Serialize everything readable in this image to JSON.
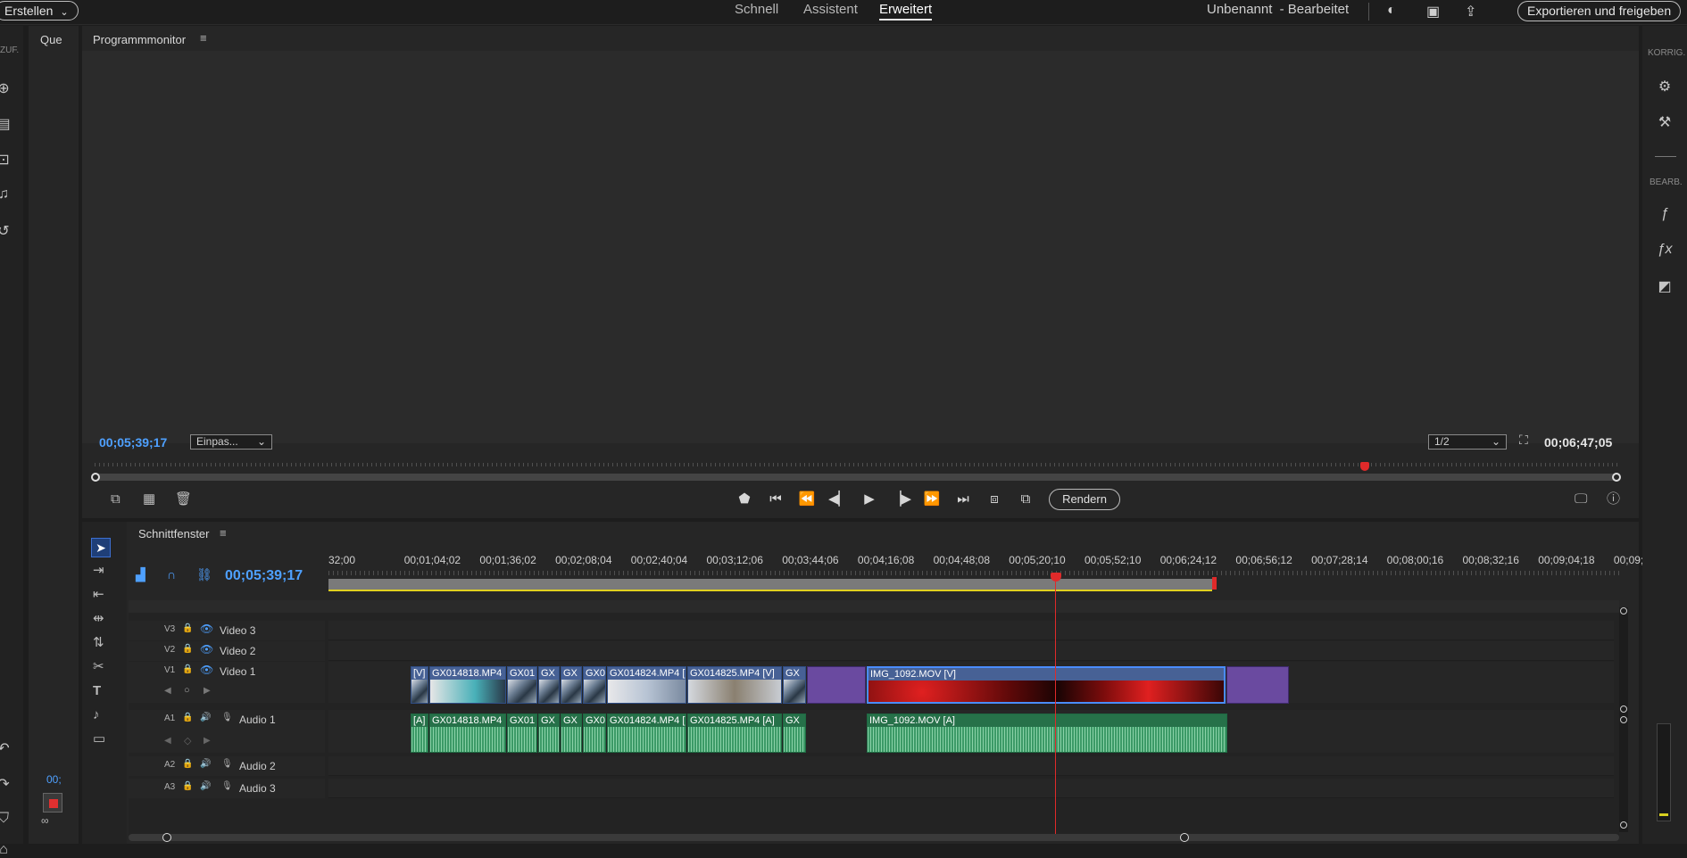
{
  "topbar": {
    "create_label": "Erstellen",
    "tabs": [
      {
        "label": "Schnell"
      },
      {
        "label": "Assistent"
      },
      {
        "label": "Erweitert"
      }
    ],
    "project_title": "Unbenannt",
    "project_status": "- Bearbeitet",
    "export_label": "Exportieren und freigeben"
  },
  "left_rail": {
    "label": "ZUF.",
    "tab_label": "Que"
  },
  "program_monitor": {
    "title": "Programmmonitor",
    "current_time": "00;05;39;17",
    "fit_select": "Einpas...",
    "quality_select": "1/2",
    "duration": "00;06;47;05",
    "playhead_fraction": 0.83,
    "render_label": "Rendern"
  },
  "timeline": {
    "title": "Schnittfenster",
    "current_time": "00;05;39;17",
    "ruler_labels": [
      "32;00",
      "00;01;04;02",
      "00;01;36;02",
      "00;02;08;04",
      "00;02;40;04",
      "00;03;12;06",
      "00;03;44;06",
      "00;04;16;08",
      "00;04;48;08",
      "00;05;20;10",
      "00;05;52;10",
      "00;06;24;12",
      "00;06;56;12",
      "00;07;28;14",
      "00;08;00;16",
      "00;08;32;16",
      "00;09;04;18",
      "00;09;"
    ],
    "tracks": {
      "v3": {
        "id": "V3",
        "name": "Video 3"
      },
      "v2": {
        "id": "V2",
        "name": "Video 2"
      },
      "v1": {
        "id": "V1",
        "name": "Video 1"
      },
      "a1": {
        "id": "A1",
        "name": "Audio 1"
      },
      "a2": {
        "id": "A2",
        "name": "Audio 2"
      },
      "a3": {
        "id": "A3",
        "name": "Audio 3"
      }
    },
    "video_clips": [
      "[V]",
      "GX014818.MP4",
      "GX01",
      "GX",
      "GX",
      "GX0",
      "GX014824.MP4 [",
      "GX014825.MP4 [V]",
      "GX",
      "IMG_1092.MOV [V]"
    ],
    "audio_clips": [
      "[A]",
      "GX014818.MP4",
      "GX01",
      "GX",
      "GX",
      "GX0",
      "GX014824.MP4 [",
      "GX014825.MP4 [A]",
      "GX",
      "IMG_1092.MOV [A]"
    ],
    "left_time": "00;"
  },
  "right_rail": {
    "section1": "KORRIG.",
    "section2": "BEARB."
  }
}
